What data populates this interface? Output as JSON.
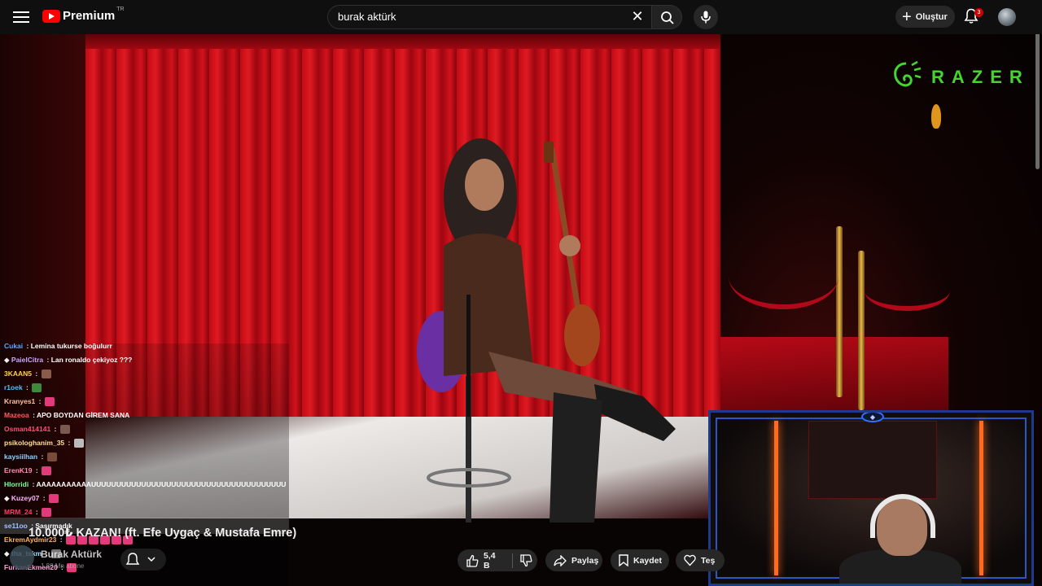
{
  "header": {
    "logo_text": "Premium",
    "logo_region": "TR",
    "search_value": "burak aktürk",
    "create_label": "Oluştur",
    "notification_count": "3"
  },
  "overlay": {
    "razer_text": "RAZER"
  },
  "chat": {
    "messages": [
      {
        "user": "Cukai",
        "color": "#5fa8ff",
        "text": "Lemina tukurse boğulurr"
      },
      {
        "user": "PaielCitra",
        "color": "#c9a7ff",
        "text": "Lan ronaldo çekiyoz ???"
      },
      {
        "user": "3KAAN5",
        "color": "#ffd34f",
        "text": ""
      },
      {
        "user": "r1oek",
        "color": "#4fc3ff",
        "text": ""
      },
      {
        "user": "Kranyes1",
        "color": "#ffc0a0",
        "text": ""
      },
      {
        "user": "Mazeoa",
        "color": "#ff5c5c",
        "text": "APO BOYDAN GİREM SANA"
      },
      {
        "user": "Osman414141",
        "color": "#ff4f7a",
        "text": ""
      },
      {
        "user": "psikologhanim_35",
        "color": "#ffe08a",
        "text": ""
      },
      {
        "user": "kaysiilhan",
        "color": "#8fd3ff",
        "text": ""
      },
      {
        "user": "ErenK19",
        "color": "#ff8fb8",
        "text": ""
      },
      {
        "user": "Hlorridi",
        "color": "#7cff9a",
        "text": "AAAAAAAAAAAUUUUUUUUUUUUUUUUUUUUUUUUUUUUUUUUUUUUUUU"
      },
      {
        "user": "Kuzey07",
        "color": "#ffb3ff",
        "text": ""
      },
      {
        "user": "MRM_24",
        "color": "#ff3b6b",
        "text": ""
      },
      {
        "user": "se11oo",
        "color": "#a0c4ff",
        "text": "Şaşırmadık"
      },
      {
        "user": "EkremAydmir23",
        "color": "#ffb15c",
        "text": ""
      },
      {
        "user": "tha_tskm",
        "color": "#9fe0ff",
        "text": ""
      },
      {
        "user": "FurkanEkmen20",
        "color": "#ff9fd6",
        "text": ""
      }
    ]
  },
  "video": {
    "title": "10.000₺ KAZAN! (ft. Efe Uygaç & Mustafa Emre)",
    "channel_name": "Burak Aktürk",
    "subscribers": "1,88 Mn abone",
    "likes": "5,4 B",
    "share_label": "Paylaş",
    "save_label": "Kaydet",
    "thanks_label": "Teş"
  },
  "colors": {
    "accent_red": "#ff0000",
    "razer_green": "#44d62c",
    "facecam_border": "#2a56c8"
  }
}
